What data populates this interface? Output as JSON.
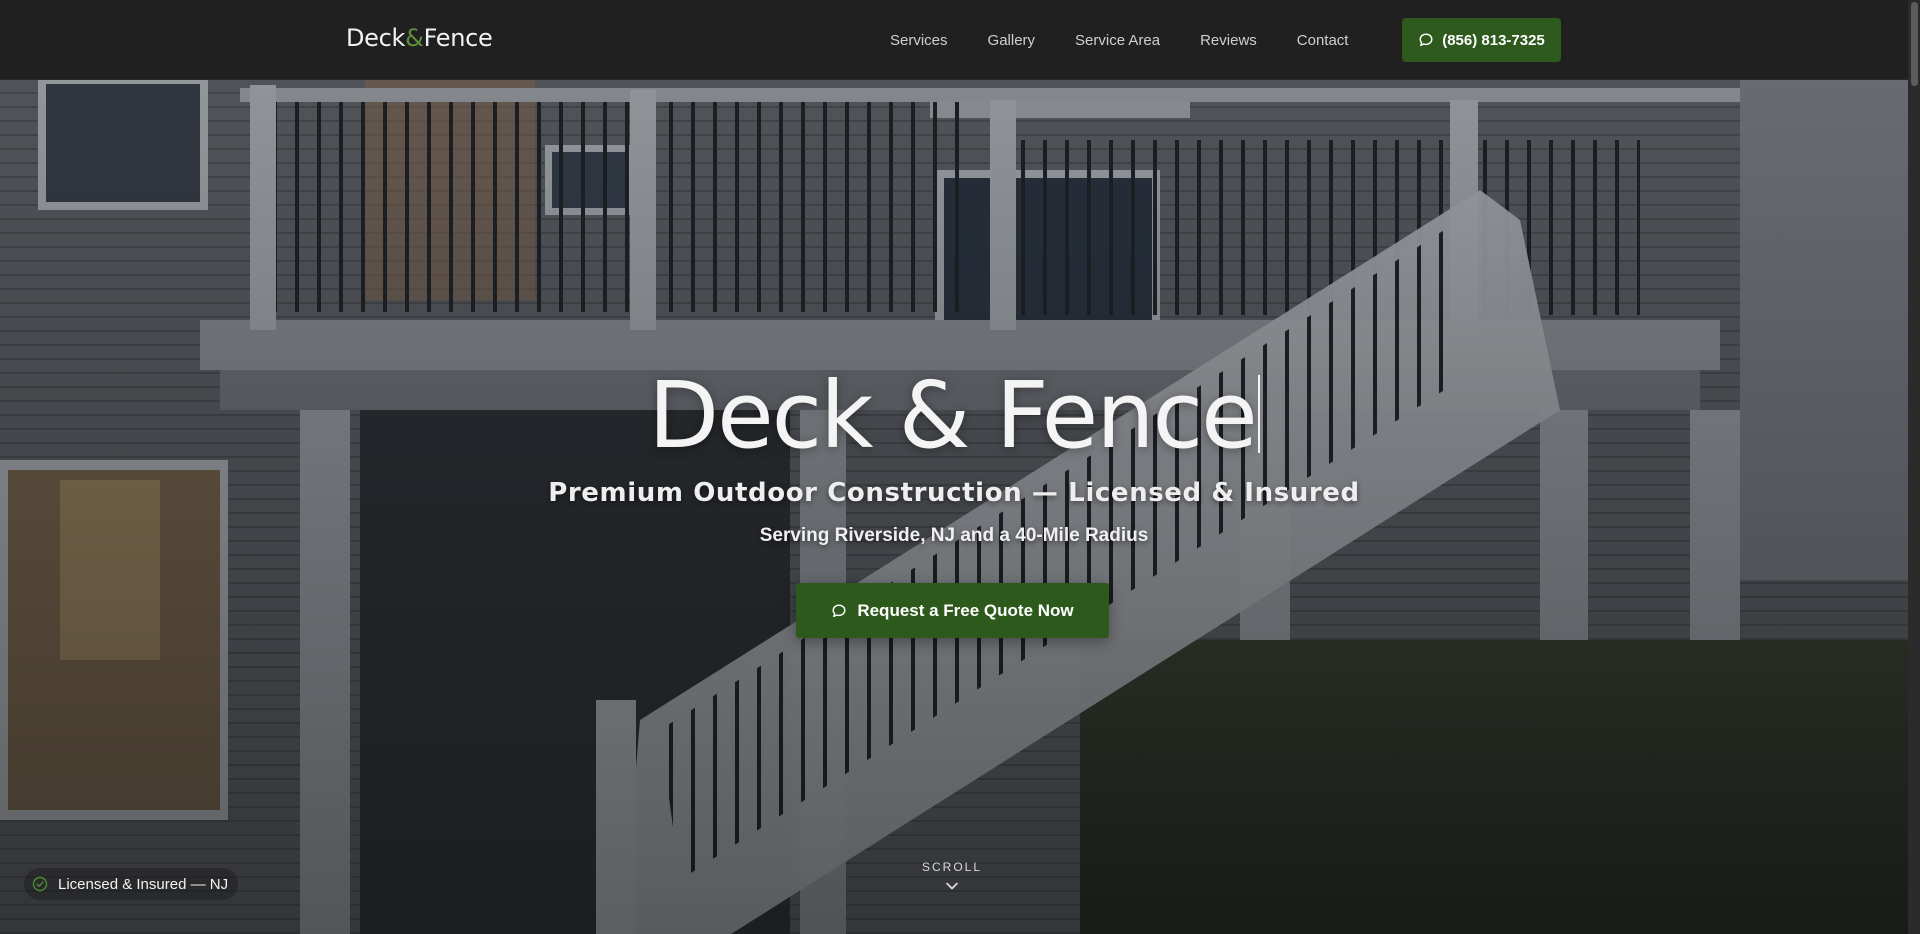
{
  "header": {
    "logo_part1": "Deck",
    "logo_amp": "&",
    "logo_part2": "Fence",
    "nav": [
      {
        "label": "Services"
      },
      {
        "label": "Gallery"
      },
      {
        "label": "Service Area"
      },
      {
        "label": "Reviews"
      },
      {
        "label": "Contact"
      }
    ],
    "phone_label": "(856) 813-7325",
    "phone_icon": "chat-bubble-icon"
  },
  "hero": {
    "title": "Deck & Fence",
    "subtitle": "Premium Outdoor Construction — Licensed & Insured",
    "service_area": "Serving Riverside, NJ and a 40-Mile Radius",
    "cta_label": "Request a Free Quote Now",
    "cta_icon": "chat-bubble-icon",
    "scroll_label": "SCROLL",
    "scroll_icon": "chevron-down-icon"
  },
  "badge": {
    "label": "Licensed & Insured — NJ",
    "icon": "check-circle-icon"
  },
  "colors": {
    "brand_green": "#2f5a1e",
    "header_bg": "#202020",
    "accent_amp": "#5f8f3c"
  }
}
